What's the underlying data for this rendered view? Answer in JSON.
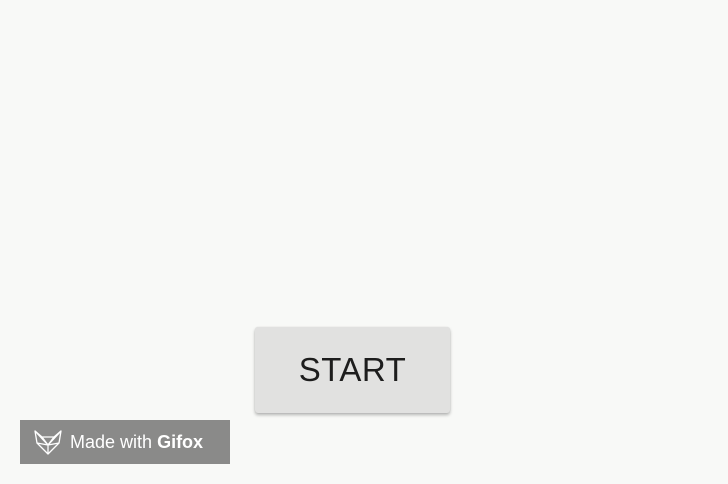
{
  "main": {
    "start_button_label": "START"
  },
  "watermark": {
    "prefix": "Made with",
    "brand": "Gifox",
    "icon": "fox-logo-icon"
  },
  "colors": {
    "background": "#f8f9f7",
    "button_bg": "#e1e1e0",
    "badge_bg": "#8a8a89"
  }
}
